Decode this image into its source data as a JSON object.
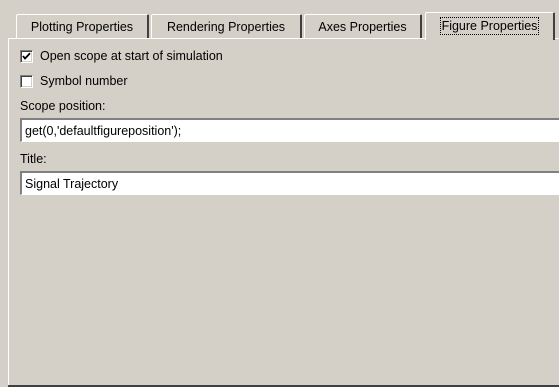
{
  "tabs": [
    {
      "label": "Plotting Properties",
      "active": false
    },
    {
      "label": "Rendering Properties",
      "active": false
    },
    {
      "label": "Axes Properties",
      "active": false
    },
    {
      "label": "Figure Properties",
      "active": true
    }
  ],
  "figure_properties": {
    "open_scope": {
      "label": "Open scope at start of simulation",
      "checked": true
    },
    "symbol_number": {
      "label": "Symbol number",
      "checked": false
    },
    "scope_position": {
      "label": "Scope position:",
      "value": "get(0,'defaultfigureposition');"
    },
    "title": {
      "label": "Title:",
      "value": "Signal Trajectory"
    }
  },
  "colors": {
    "face": "#d4d0c8",
    "highlight": "#ffffff",
    "shadow": "#808080",
    "dark_shadow": "#404040"
  }
}
